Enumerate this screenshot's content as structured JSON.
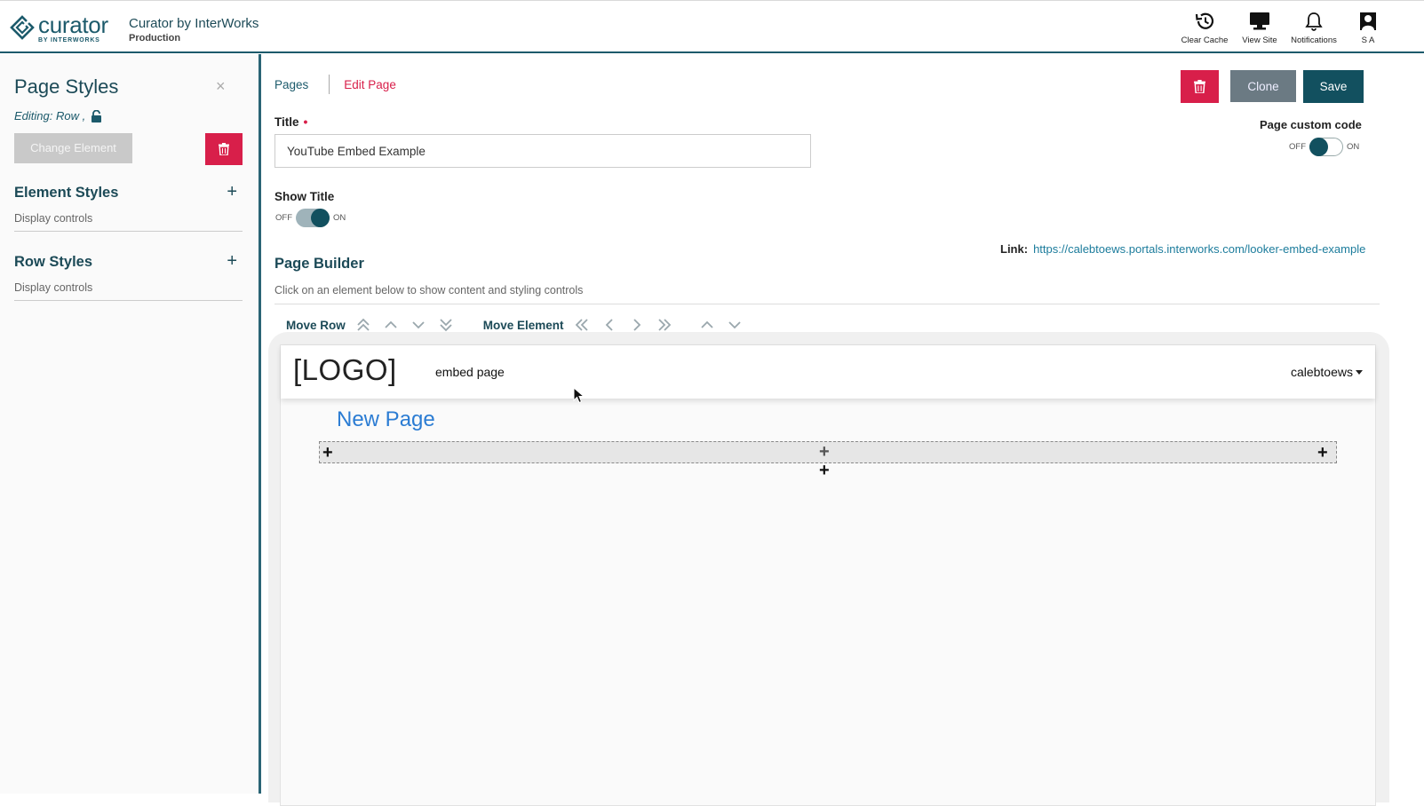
{
  "header": {
    "logo_word": "curator",
    "logo_sub": "BY INTERWORKS",
    "site_title": "Curator by InterWorks",
    "site_env": "Production",
    "actions": [
      {
        "label": "Clear Cache",
        "icon": "history-icon"
      },
      {
        "label": "View Site",
        "icon": "monitor-icon"
      },
      {
        "label": "Notifications",
        "icon": "bell-icon"
      },
      {
        "label": "S A",
        "icon": "user-icon"
      }
    ]
  },
  "left_panel": {
    "title": "Page Styles",
    "close": "×",
    "editing_label": "Editing: Row ,",
    "change_element_label": "Change Element",
    "sections": [
      {
        "title": "Element Styles",
        "subtitle": "Display controls",
        "toggle": "+"
      },
      {
        "title": "Row Styles",
        "subtitle": "Display controls",
        "toggle": "+"
      }
    ]
  },
  "breadcrumb": {
    "pages": "Pages",
    "edit_page": "Edit Page"
  },
  "buttons": {
    "clone": "Clone",
    "save": "Save"
  },
  "page_custom_code": {
    "label": "Page custom code",
    "off": "OFF",
    "on": "ON",
    "enabled": false
  },
  "title_field": {
    "label": "Title",
    "required_mark": "•",
    "value": "YouTube Embed Example"
  },
  "show_title": {
    "label": "Show Title",
    "off": "OFF",
    "on": "ON",
    "enabled": true
  },
  "link": {
    "label": "Link:",
    "url": "https://calebtoews.portals.interworks.com/looker-embed-example"
  },
  "page_builder": {
    "title": "Page Builder",
    "subtitle": "Click on an element below to show content and styling controls",
    "move_row_label": "Move Row",
    "move_element_label": "Move Element"
  },
  "canvas": {
    "logo": "[LOGO]",
    "nav_link": "embed page",
    "user": "calebtoews",
    "page_title": "New Page",
    "plus": "+"
  },
  "colors": {
    "primary": "#1c5a6b",
    "danger": "#d81f4a",
    "save": "#12505f",
    "clone": "#6b7a83",
    "link": "#1c7c9c",
    "page_title": "#2b7cd3"
  }
}
